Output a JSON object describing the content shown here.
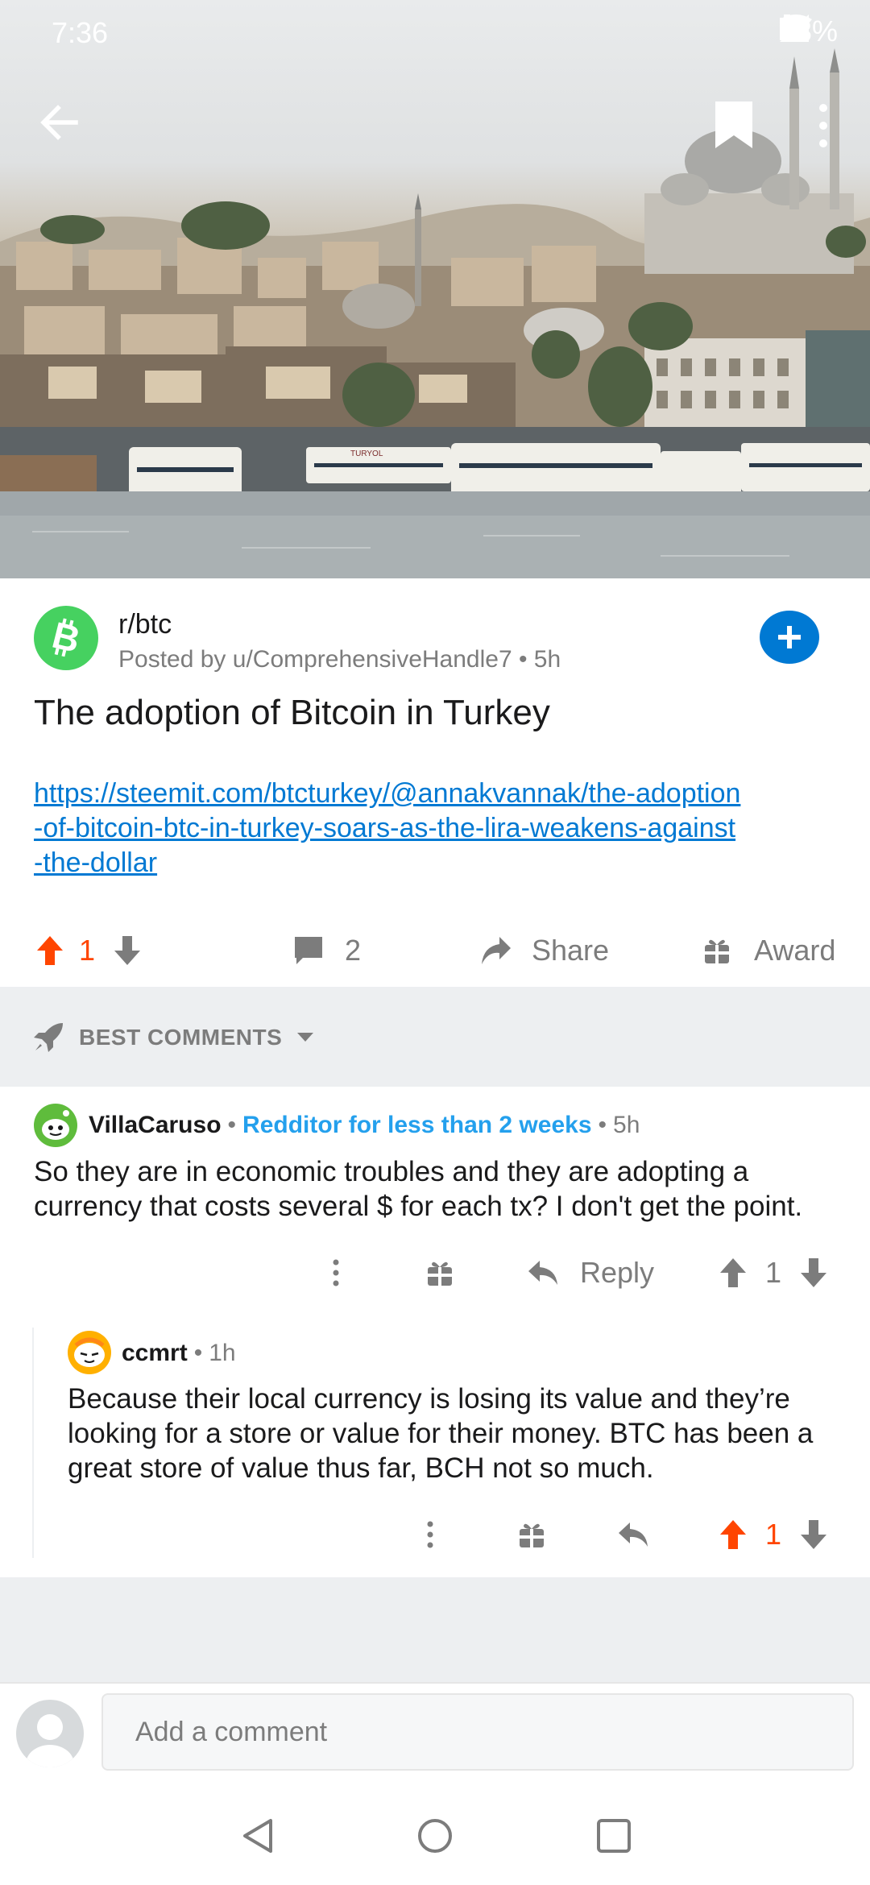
{
  "status_bar": {
    "time": "7:36",
    "battery": "73%"
  },
  "colors": {
    "upvote": "#ff4500",
    "link": "#0079d3",
    "flair": "#24a0ed",
    "subreddit_icon": "#46d160",
    "band": "#edeff1"
  },
  "hero": {
    "icons": {
      "back": "arrow-left-icon",
      "save": "bookmark-icon",
      "more": "more-vertical-icon"
    },
    "sign_text": "TURYOL"
  },
  "post": {
    "subreddit": "r/btc",
    "meta": "Posted by u/ComprehensiveHandle7 • 5h",
    "title": "The adoption of Bitcoin in Turkey",
    "link": "https://steemit.com/btcturkey/@annakvannak/the-adoption-of-bitcoin-btc-in-turkey-soars-as-the-lira-weakens-against-the-dollar",
    "link_lines": [
      "https://steemit.com/btcturkey/@annakvannak/the-adoption",
      "-of-bitcoin-btc-in-turkey-soars-as-the-lira-weakens-against",
      "-the-dollar"
    ],
    "score": "1",
    "comment_count": "2",
    "share_label": "Share",
    "award_label": "Award"
  },
  "sort": {
    "label": "BEST COMMENTS"
  },
  "comments": [
    {
      "author": "VillaCaruso",
      "flair": "Redditor for less than 2 weeks",
      "age": "5h",
      "body_lines": [
        "So they are in economic troubles and they are adopting a",
        "currency that costs several $ for each tx? I don't get the point."
      ],
      "reply_label": "Reply",
      "score": "1"
    },
    {
      "author": "ccmrt",
      "age": "1h",
      "body_lines": [
        "Because their local currency is losing its value and they’re",
        "looking for a store or value for their money. BTC has been a",
        "great store of value thus far, BCH not so much."
      ],
      "score": "1"
    }
  ],
  "composer": {
    "placeholder": "Add a comment"
  }
}
